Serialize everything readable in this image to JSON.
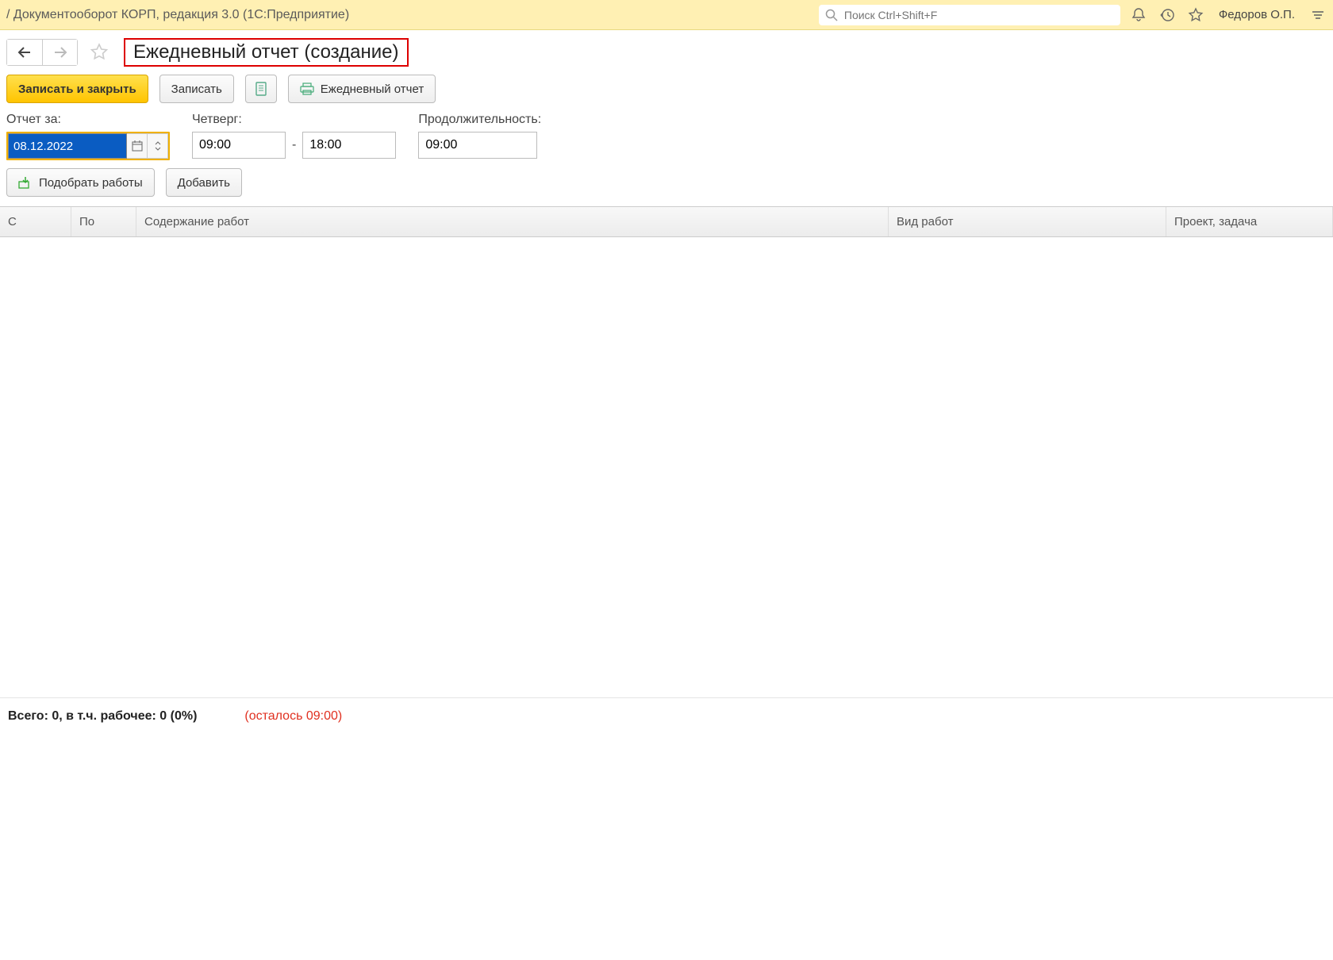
{
  "topbar": {
    "title": "/ Документооборот КОРП, редакция 3.0  (1С:Предприятие)",
    "search_placeholder": "Поиск Ctrl+Shift+F",
    "user": "Федоров О.П."
  },
  "header": {
    "title": "Ежедневный отчет (создание)"
  },
  "toolbar": {
    "save_close": "Записать и закрыть",
    "save": "Записать",
    "daily_report": "Ежедневный отчет"
  },
  "fields": {
    "date_label": "Отчет за:",
    "date_value": "08.12.2022",
    "day_label": "Четверг:",
    "time_from": "09:00",
    "time_to": "18:00",
    "duration_label": "Продолжительность:",
    "duration": "09:00"
  },
  "toolbar2": {
    "pick": "Подобрать работы",
    "add": "Добавить"
  },
  "grid": {
    "cols": {
      "from": "С",
      "to": "По",
      "content": "Содержание работ",
      "type": "Вид работ",
      "proj": "Проект, задача"
    }
  },
  "status": {
    "total": "Всего: 0, в т.ч. рабочее: 0 (0%)",
    "remain": "(осталось 09:00)"
  }
}
